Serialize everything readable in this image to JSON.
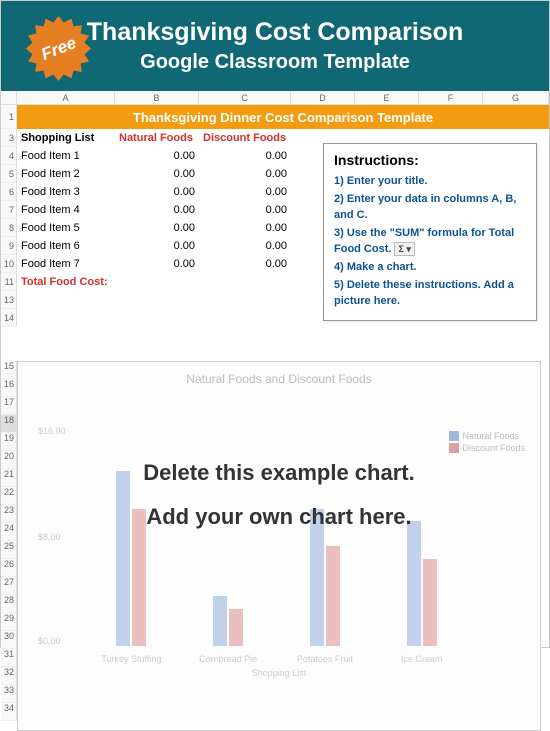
{
  "badge": {
    "text": "Free"
  },
  "header": {
    "title": "Thanksgiving Cost Comparison",
    "subtitle": "Google Classroom Template"
  },
  "columns": [
    "",
    "A",
    "B",
    "C",
    "D",
    "E",
    "F",
    "G"
  ],
  "title_row": "Thanksgiving Dinner Cost Comparison Template",
  "table": {
    "head": {
      "a": "Shopping List",
      "b": "Natural Foods",
      "c": "Discount Foods"
    },
    "rows": [
      {
        "a": "Food Item 1",
        "b": "0.00",
        "c": "0.00"
      },
      {
        "a": "Food Item 2",
        "b": "0.00",
        "c": "0.00"
      },
      {
        "a": "Food Item 3",
        "b": "0.00",
        "c": "0.00"
      },
      {
        "a": "Food Item 4",
        "b": "0.00",
        "c": "0.00"
      },
      {
        "a": "Food Item 5",
        "b": "0.00",
        "c": "0.00"
      },
      {
        "a": "Food Item 6",
        "b": "0.00",
        "c": "0.00"
      },
      {
        "a": "Food Item 7",
        "b": "0.00",
        "c": "0.00"
      }
    ],
    "total_label": "Total Food Cost:"
  },
  "instructions": {
    "title": "Instructions:",
    "steps": [
      "1) Enter your title.",
      "2) Enter your data in columns  A, B, and C.",
      "3) Use the \"SUM\" formula for  Total Food Cost.",
      "4) Make a chart.",
      "5) Delete these instructions. Add a picture here."
    ],
    "sigma": "Σ ▾"
  },
  "chart_data": {
    "type": "bar",
    "title": "Natural Foods and Discount Foods",
    "xlabel": "Shopping List",
    "ylabel": "",
    "ylim": [
      0,
      16
    ],
    "yticks": [
      "$16.00",
      "$8.00",
      "$0.00"
    ],
    "categories": [
      "Turkey Stuffing",
      "Cornbread Pie",
      "Potatoes Fruit",
      "Ice Cream"
    ],
    "series": [
      {
        "name": "Natural Foods",
        "color": "#4a7ec9",
        "values": [
          14,
          4,
          11,
          10
        ]
      },
      {
        "name": "Discount Foods",
        "color": "#c94a4a",
        "values": [
          11,
          3,
          8,
          7
        ]
      }
    ],
    "overlay": {
      "line1": "Delete this example chart.",
      "line2": "Add your own chart here."
    }
  },
  "row_numbers_visible": [
    "1",
    "3",
    "4",
    "5",
    "6",
    "7",
    "8",
    "9",
    "10",
    "11",
    "13",
    "14",
    "15",
    "16",
    "17",
    "18",
    "19",
    "20",
    "21",
    "22",
    "23",
    "24",
    "25",
    "26",
    "27",
    "28",
    "29",
    "30",
    "31",
    "32",
    "33",
    "34"
  ]
}
